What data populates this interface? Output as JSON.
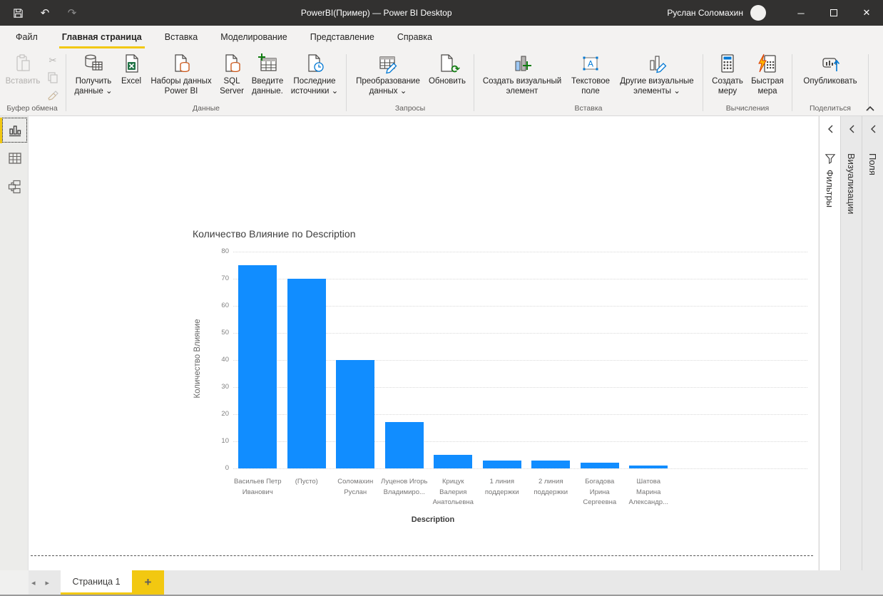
{
  "window": {
    "title": "PowerBI(Пример) — Power BI Desktop",
    "user_name": "Руслан Соломахин"
  },
  "menu_tabs": {
    "file": "Файл",
    "home": "Главная страница",
    "insert": "Вставка",
    "modeling": "Моделирование",
    "view": "Представление",
    "help": "Справка"
  },
  "ribbon": {
    "clipboard_group": "Буфер обмена",
    "paste": "Вставить",
    "data_group": "Данные",
    "get_data": "Получить данные ⌄",
    "excel": "Excel",
    "pbi_datasets": "Наборы данных Power BI",
    "sql_server": "SQL Server",
    "enter_data": "Введите данные.",
    "recent_sources": "Последние источники ⌄",
    "queries_group": "Запросы",
    "transform": "Преобразование данных ⌄",
    "refresh": "Обновить",
    "insert_group": "Вставка",
    "new_visual": "Создать визуальный элемент",
    "text_box": "Текстовое поле",
    "more_visuals": "Другие визуальные элементы ⌄",
    "calc_group": "Вычисления",
    "new_measure": "Создать меру",
    "quick_measure": "Быстрая мера",
    "share_group": "Поделиться",
    "publish": "Опубликовать"
  },
  "panels": {
    "filters": "Фильтры",
    "visualizations": "Визуализации",
    "fields": "Поля"
  },
  "footer": {
    "page_tab": "Страница 1",
    "add_tab": "+"
  },
  "colors": {
    "accent_yellow": "#F2C811",
    "bar_blue": "#118DFF",
    "titlebar": "#323130"
  },
  "chart_data": {
    "type": "bar",
    "title": "Количество Влияние по Description",
    "categories": [
      "Васильев Петр Иванович",
      "(Пусто)",
      "Соломахин Руслан",
      "Луценов Игорь Владимиро...",
      "Крицук Валерия Анатольевна",
      "1 линия поддержки",
      "2 линия поддержки",
      "Богадова Ирина Сергеевна",
      "Шатова Марина Александр..."
    ],
    "values": [
      75,
      70,
      40,
      17,
      5,
      3,
      3,
      2,
      1
    ],
    "xlabel": "Description",
    "ylabel": "Количество Влияние",
    "ylim": [
      0,
      80
    ],
    "ytick_step": 10,
    "legend": "none",
    "grid": "horizontal-dotted",
    "bar_color": "#118DFF"
  }
}
